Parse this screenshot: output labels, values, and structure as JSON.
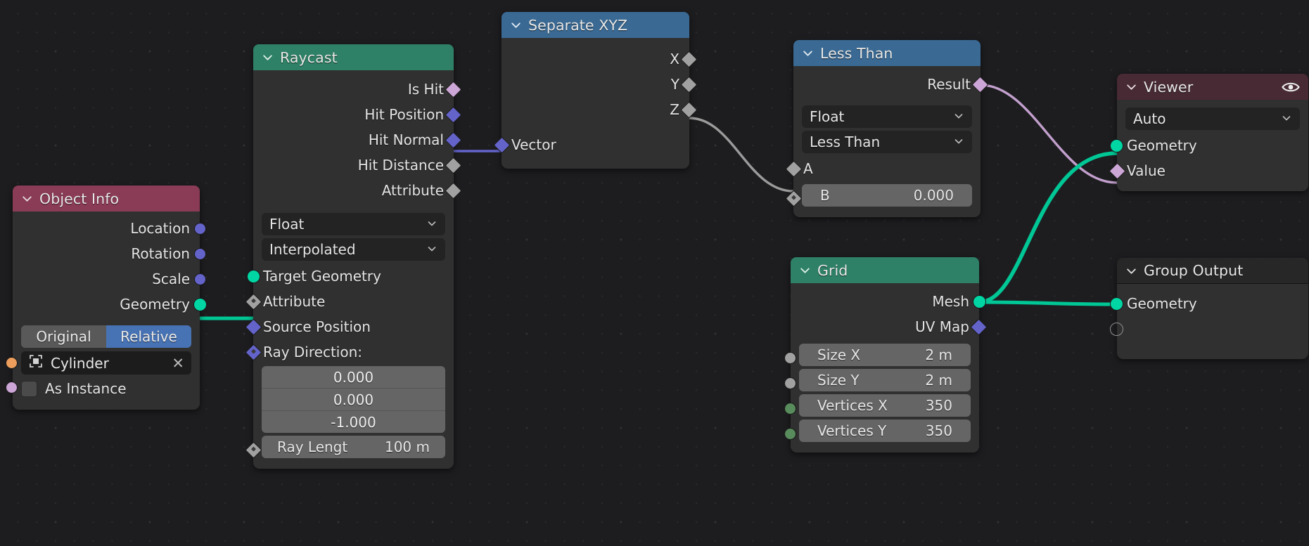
{
  "editor": {
    "name": "Geometry Node Editor",
    "background": "#1d1d20"
  },
  "colors": {
    "header_geometry": "#2e8066",
    "header_converter": "#3a6a94",
    "header_input": "#8a3b55",
    "header_viewer": "#472a34",
    "header_group": "#272727",
    "node_body": "#303030",
    "socket_geometry": "#00d6a3",
    "socket_vector": "#6363ca",
    "socket_float": "#a1a1a1",
    "socket_boolean": "#cca6d6",
    "socket_object": "#ed9e5c",
    "socket_int": "#598c5c",
    "toggle_active": "#4772b3",
    "wire_geometry": "#00c795",
    "wire_boolean": "#c3a0cd",
    "wire_vector": "#6363ca",
    "wire_float": "#9b9b9b"
  },
  "nodes": {
    "object_info": {
      "title": "Object Info",
      "outputs": [
        {
          "label": "Location",
          "socket": "vector"
        },
        {
          "label": "Rotation",
          "socket": "vector"
        },
        {
          "label": "Scale",
          "socket": "vector"
        },
        {
          "label": "Geometry",
          "socket": "geometry"
        }
      ],
      "transform_space": {
        "options": [
          "Original",
          "Relative"
        ],
        "selected": "Relative"
      },
      "object_field": {
        "value": "Cylinder",
        "clear_label": "✕"
      },
      "as_instance": {
        "label": "As Instance",
        "checked": false
      }
    },
    "raycast": {
      "title": "Raycast",
      "outputs": [
        {
          "label": "Is Hit",
          "socket": "boolean"
        },
        {
          "label": "Hit Position",
          "socket": "vector"
        },
        {
          "label": "Hit Normal",
          "socket": "vector"
        },
        {
          "label": "Hit Distance",
          "socket": "float"
        },
        {
          "label": "Attribute",
          "socket": "float"
        }
      ],
      "data_type": {
        "selected": "Float"
      },
      "mapping": {
        "selected": "Interpolated"
      },
      "inputs": [
        {
          "label": "Target Geometry",
          "socket": "geometry"
        },
        {
          "label": "Attribute",
          "socket": "float_unconnected"
        },
        {
          "label": "Source Position",
          "socket": "vector"
        },
        {
          "label": "Ray Direction:",
          "socket": "vector_unconnected"
        }
      ],
      "ray_direction": [
        "0.000",
        "0.000",
        "-1.000"
      ],
      "ray_length": {
        "label": "Ray Lengt",
        "value": "100 m"
      }
    },
    "separate_xyz": {
      "title": "Separate XYZ",
      "outputs": [
        {
          "label": "X",
          "socket": "float"
        },
        {
          "label": "Y",
          "socket": "float"
        },
        {
          "label": "Z",
          "socket": "float"
        }
      ],
      "inputs": [
        {
          "label": "Vector",
          "socket": "vector"
        }
      ]
    },
    "less_than": {
      "title": "Less Than",
      "outputs": [
        {
          "label": "Result",
          "socket": "boolean"
        }
      ],
      "data_type": {
        "selected": "Float"
      },
      "operation": {
        "selected": "Less Than"
      },
      "inputs": [
        {
          "label": "A",
          "socket": "float"
        },
        {
          "label": "B",
          "socket": "float",
          "value": "0.000"
        }
      ]
    },
    "grid": {
      "title": "Grid",
      "outputs": [
        {
          "label": "Mesh",
          "socket": "geometry"
        },
        {
          "label": "UV Map",
          "socket": "vector"
        }
      ],
      "fields": [
        {
          "label": "Size X",
          "value": "2 m",
          "socket": "float"
        },
        {
          "label": "Size Y",
          "value": "2 m",
          "socket": "float"
        },
        {
          "label": "Vertices X",
          "value": "350",
          "socket": "int"
        },
        {
          "label": "Vertices Y",
          "value": "350",
          "socket": "int"
        }
      ]
    },
    "viewer": {
      "title": "Viewer",
      "icon": "eye-icon",
      "domain": {
        "selected": "Auto"
      },
      "inputs": [
        {
          "label": "Geometry",
          "socket": "geometry"
        },
        {
          "label": "Value",
          "socket": "boolean"
        }
      ]
    },
    "group_output": {
      "title": "Group Output",
      "inputs": [
        {
          "label": "Geometry",
          "socket": "geometry"
        },
        {
          "label": "",
          "socket": "empty"
        }
      ]
    }
  },
  "links": [
    {
      "from": "object_info.Geometry",
      "to": "raycast.Target Geometry",
      "type": "geometry"
    },
    {
      "from": "raycast.Hit Normal",
      "to": "separate_xyz.Vector",
      "type": "vector"
    },
    {
      "from": "separate_xyz.Z",
      "to": "less_than.A",
      "type": "float"
    },
    {
      "from": "less_than.Result",
      "to": "viewer.Value",
      "type": "boolean"
    },
    {
      "from": "grid.Mesh",
      "to": "viewer.Geometry",
      "type": "geometry"
    },
    {
      "from": "grid.Mesh",
      "to": "group_output.Geometry",
      "type": "geometry"
    }
  ]
}
